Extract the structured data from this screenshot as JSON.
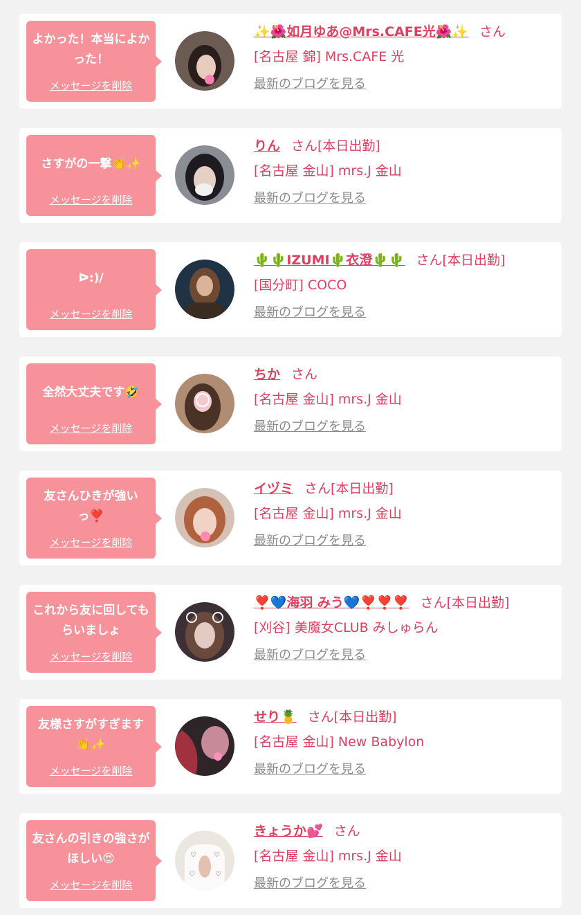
{
  "cards": [
    {
      "message": "よかった！本当によかった！",
      "delete_label": "メッセージを削除",
      "name": "✨🌺如月ゆあ@Mrs.CAFE光🌺✨",
      "suffix": "さん",
      "shop": "[名古屋 錦] Mrs.CAFE 光",
      "blog_label": "最新のブログを見る",
      "avatar_bg": "#4a3b34"
    },
    {
      "message": "さすがの一撃👏✨",
      "delete_label": "メッセージを削除",
      "name": "りん",
      "suffix": "さん[本日出勤]",
      "shop": "[名古屋 金山] mrs.J 金山",
      "blog_label": "最新のブログを見る",
      "avatar_bg": "#2e2b30"
    },
    {
      "message": "ᐅ:)/",
      "delete_label": "メッセージを削除",
      "name": "🌵🌵IZUMI🌵衣澄🌵🌵",
      "suffix": "さん[本日出勤]",
      "shop": "[国分町] COCO",
      "blog_label": "最新のブログを見る",
      "avatar_bg": "#1f3344"
    },
    {
      "message": "全然大丈夫です🤣",
      "delete_label": "メッセージを削除",
      "name": "ちか",
      "suffix": "さん",
      "shop": "[名古屋 金山] mrs.J 金山",
      "blog_label": "最新のブログを見る",
      "avatar_bg": "#b08c73"
    },
    {
      "message": "友さんひきが強いっ❣️",
      "delete_label": "メッセージを削除",
      "name": "イヅミ",
      "suffix": "さん[本日出勤]",
      "shop": "[名古屋 金山] mrs.J 金山",
      "blog_label": "最新のブログを見る",
      "avatar_bg": "#c48b6b"
    },
    {
      "message": "これから友に回してもらいましょ",
      "delete_label": "メッセージを削除",
      "name": "❣️💙海羽 みう💙❣️❣️❣️",
      "suffix": "さん[本日出勤]",
      "shop": "[刈谷] 美魔女CLUB みしゅらん",
      "blog_label": "最新のブログを見る",
      "avatar_bg": "#3c3036"
    },
    {
      "message": "友様さすがすぎます👏✨",
      "delete_label": "メッセージを削除",
      "name": "せり🍍",
      "suffix": "さん[本日出勤]",
      "shop": "[名古屋 金山] New Babylon",
      "blog_label": "最新のブログを見る",
      "avatar_bg": "#3a2a30"
    },
    {
      "message": "友さんの引きの強さがほしい😍",
      "delete_label": "メッセージを削除",
      "name": "きょうか💕",
      "suffix": "さん",
      "shop": "[名古屋 金山] mrs.J 金山",
      "blog_label": "最新のブログを見る",
      "avatar_bg": "#e8e2dc"
    }
  ],
  "colors": {
    "page_bg": "#f2f2f2",
    "bubble": "#f7919a",
    "accent_text": "#e0405f",
    "link_gray": "#8a8a8a"
  }
}
